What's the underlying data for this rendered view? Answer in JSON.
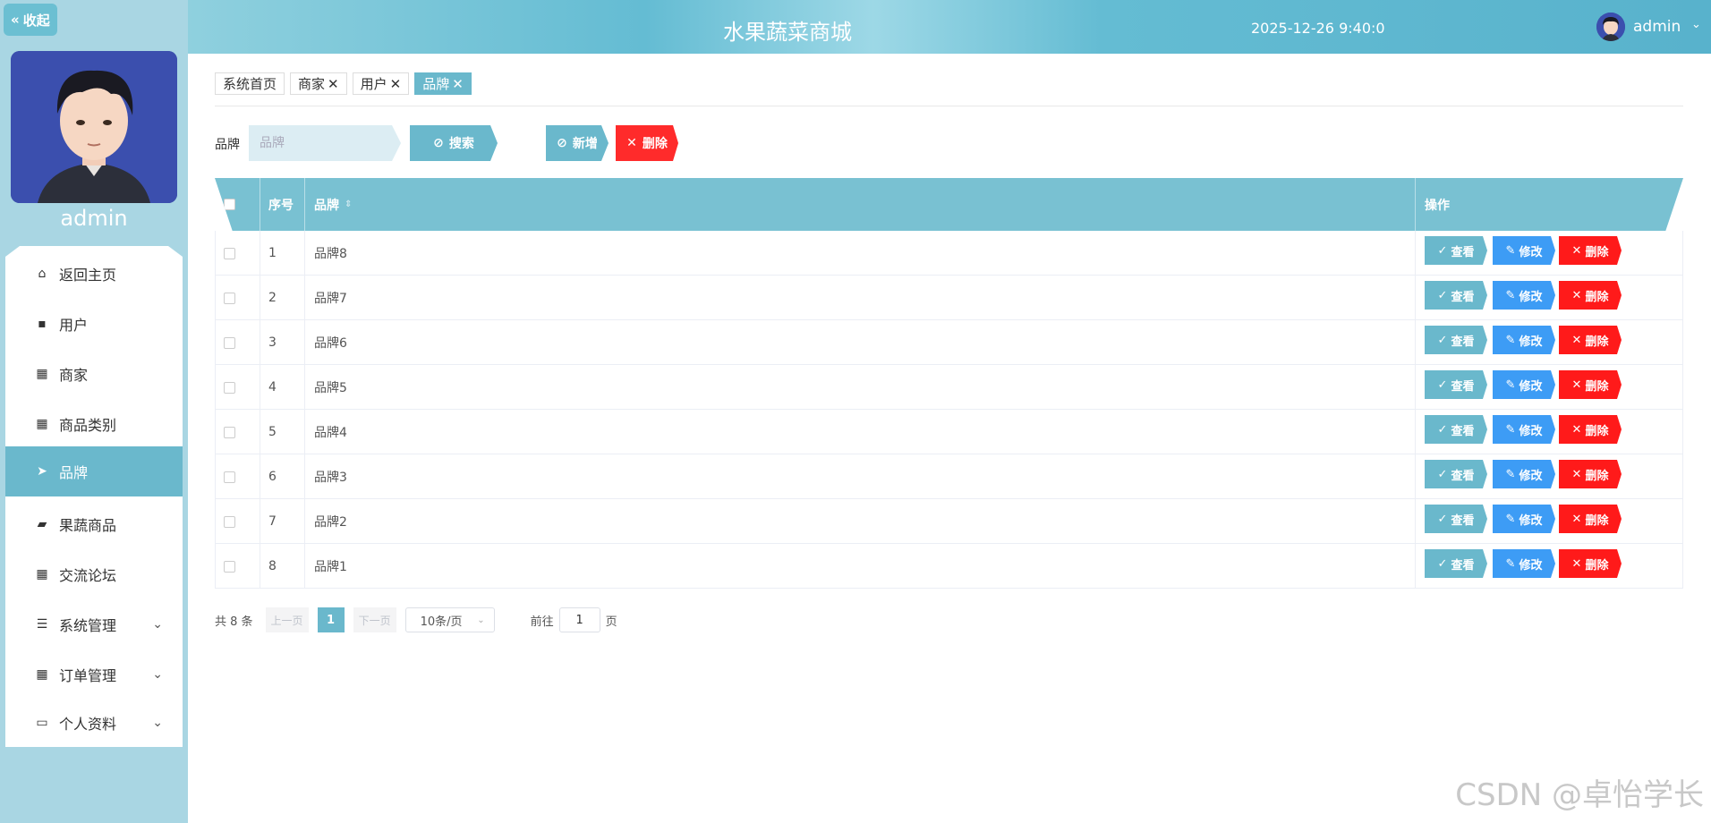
{
  "sidebar": {
    "collapse_label": "收起",
    "admin_name": "admin",
    "items": [
      {
        "label": "返回主页",
        "icon": "home-icon"
      },
      {
        "label": "用户",
        "icon": "chat-icon"
      },
      {
        "label": "商家",
        "icon": "grid-icon"
      },
      {
        "label": "商品类别",
        "icon": "grid-icon"
      },
      {
        "label": "品牌",
        "icon": "send-icon",
        "active": true
      },
      {
        "label": "果蔬商品",
        "icon": "wallet-icon"
      },
      {
        "label": "交流论坛",
        "icon": "grid-icon"
      },
      {
        "label": "系统管理",
        "icon": "list-icon",
        "expandable": true
      },
      {
        "label": "订单管理",
        "icon": "grid-icon",
        "expandable": true
      },
      {
        "label": "个人资料",
        "icon": "card-icon",
        "expandable": true
      }
    ]
  },
  "header": {
    "title": "水果蔬菜商城",
    "time": "2025-12-26 9:40:0",
    "user": "admin"
  },
  "tags": [
    {
      "label": "系统首页",
      "closable": false
    },
    {
      "label": "商家",
      "closable": true
    },
    {
      "label": "用户",
      "closable": true
    },
    {
      "label": "品牌",
      "closable": true,
      "active": true
    }
  ],
  "search": {
    "label": "品牌",
    "placeholder": "品牌",
    "search_button": "搜索",
    "add_button": "新增",
    "delete_button": "删除"
  },
  "table": {
    "headers": {
      "index": "序号",
      "brand": "品牌",
      "actions": "操作"
    },
    "rows": [
      {
        "index": "1",
        "brand": "品牌8"
      },
      {
        "index": "2",
        "brand": "品牌7"
      },
      {
        "index": "3",
        "brand": "品牌6"
      },
      {
        "index": "4",
        "brand": "品牌5"
      },
      {
        "index": "5",
        "brand": "品牌4"
      },
      {
        "index": "6",
        "brand": "品牌3"
      },
      {
        "index": "7",
        "brand": "品牌2"
      },
      {
        "index": "8",
        "brand": "品牌1"
      }
    ],
    "row_actions": {
      "view": "查看",
      "edit": "修改",
      "delete": "删除"
    }
  },
  "pager": {
    "total": "共 8 条",
    "prev": "上一页",
    "current": "1",
    "next": "下一页",
    "page_size": "10条/页",
    "goto_label": "前往",
    "goto_value": "1",
    "page_unit": "页"
  },
  "watermark": "CSDN @卓怡学长",
  "colors": {
    "accent": "#6ab8cc",
    "edit": "#3d9cf5",
    "danger": "#ff1a1a"
  }
}
